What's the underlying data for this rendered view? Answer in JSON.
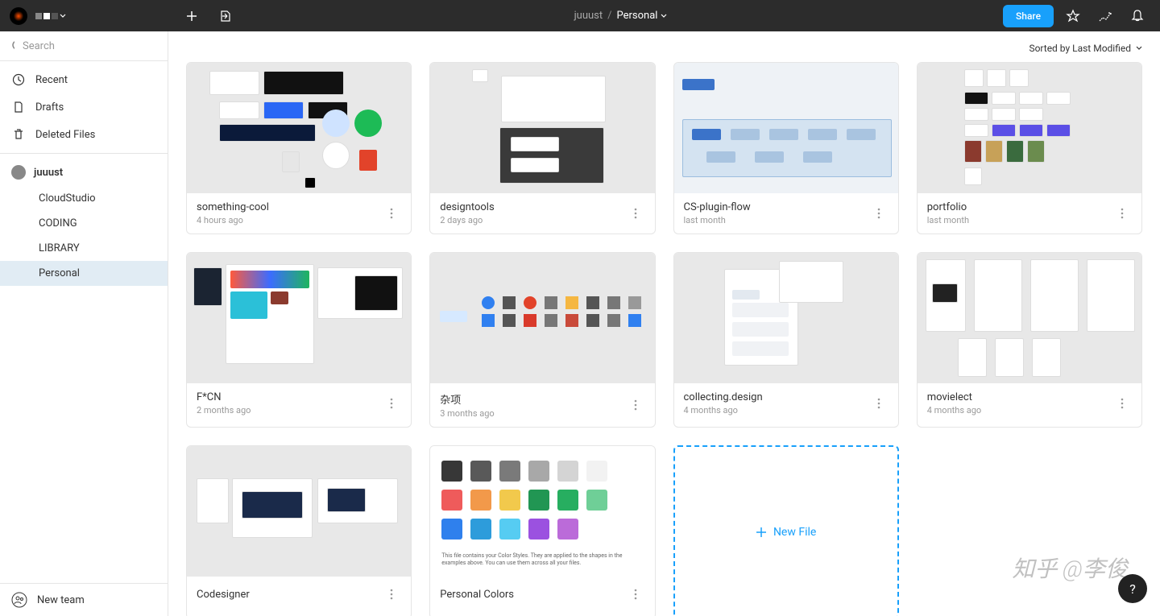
{
  "topbar": {
    "share_label": "Share"
  },
  "breadcrumb": {
    "parent": "juuust",
    "sep": "/",
    "current": "Personal"
  },
  "search": {
    "placeholder": "Search"
  },
  "nav": {
    "recent": "Recent",
    "drafts": "Drafts",
    "deleted": "Deleted Files"
  },
  "team": {
    "name": "juuust",
    "items": [
      "CloudStudio",
      "CODING",
      "LIBRARY",
      "Personal"
    ]
  },
  "new_team": "New team",
  "sort": {
    "label": "Sorted by Last Modified"
  },
  "files": [
    {
      "title": "something-cool",
      "time": "4 hours ago"
    },
    {
      "title": "designtools",
      "time": "2 days ago"
    },
    {
      "title": "CS-plugin-flow",
      "time": "last month"
    },
    {
      "title": "portfolio",
      "time": "last month"
    },
    {
      "title": "F*CN",
      "time": "2 months ago"
    },
    {
      "title": "杂项",
      "time": "3 months ago"
    },
    {
      "title": "collecting.design",
      "time": "4 months ago"
    },
    {
      "title": "movielect",
      "time": "4 months ago"
    },
    {
      "title": "Codesigner",
      "time": ""
    },
    {
      "title": "Personal Colors",
      "time": ""
    }
  ],
  "new_file": "New File",
  "help": "?",
  "colors_caption": "This file contains your Color Styles. They are applied to the shapes in the examples above. You can use them across all your files.",
  "watermark": "知乎 @李俊"
}
